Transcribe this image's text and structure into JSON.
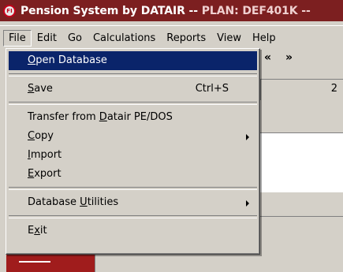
{
  "window": {
    "icon_label": "FI",
    "title_prefix": "Pension System by DATAIR -- ",
    "title_plan": "PLAN: DEF401K --"
  },
  "menubar": {
    "items": [
      "File",
      "Edit",
      "Go",
      "Calculations",
      "Reports",
      "View",
      "Help"
    ]
  },
  "toolbar": {
    "prev_label": "«",
    "next_label": "»",
    "tab_value": "2"
  },
  "file_menu": {
    "open_database": {
      "pre": "",
      "key": "O",
      "post": "pen Database"
    },
    "save": {
      "pre": "",
      "key": "S",
      "post": "ave",
      "shortcut": "Ctrl+S"
    },
    "transfer": {
      "pre": "Transfer from ",
      "key": "D",
      "post": "atair PE/DOS"
    },
    "copy": {
      "pre": "",
      "key": "C",
      "post": "opy"
    },
    "import": {
      "pre": "",
      "key": "I",
      "post": "mport"
    },
    "export": {
      "pre": "",
      "key": "E",
      "post": "xport"
    },
    "database_utilities": {
      "pre": "Database ",
      "key": "U",
      "post": "tilities"
    },
    "exit": {
      "pre": "E",
      "key": "x",
      "post": "it"
    }
  },
  "colors": {
    "titlebar": "#7c1f20",
    "highlight": "#0a246a",
    "face": "#d4d0c8"
  }
}
